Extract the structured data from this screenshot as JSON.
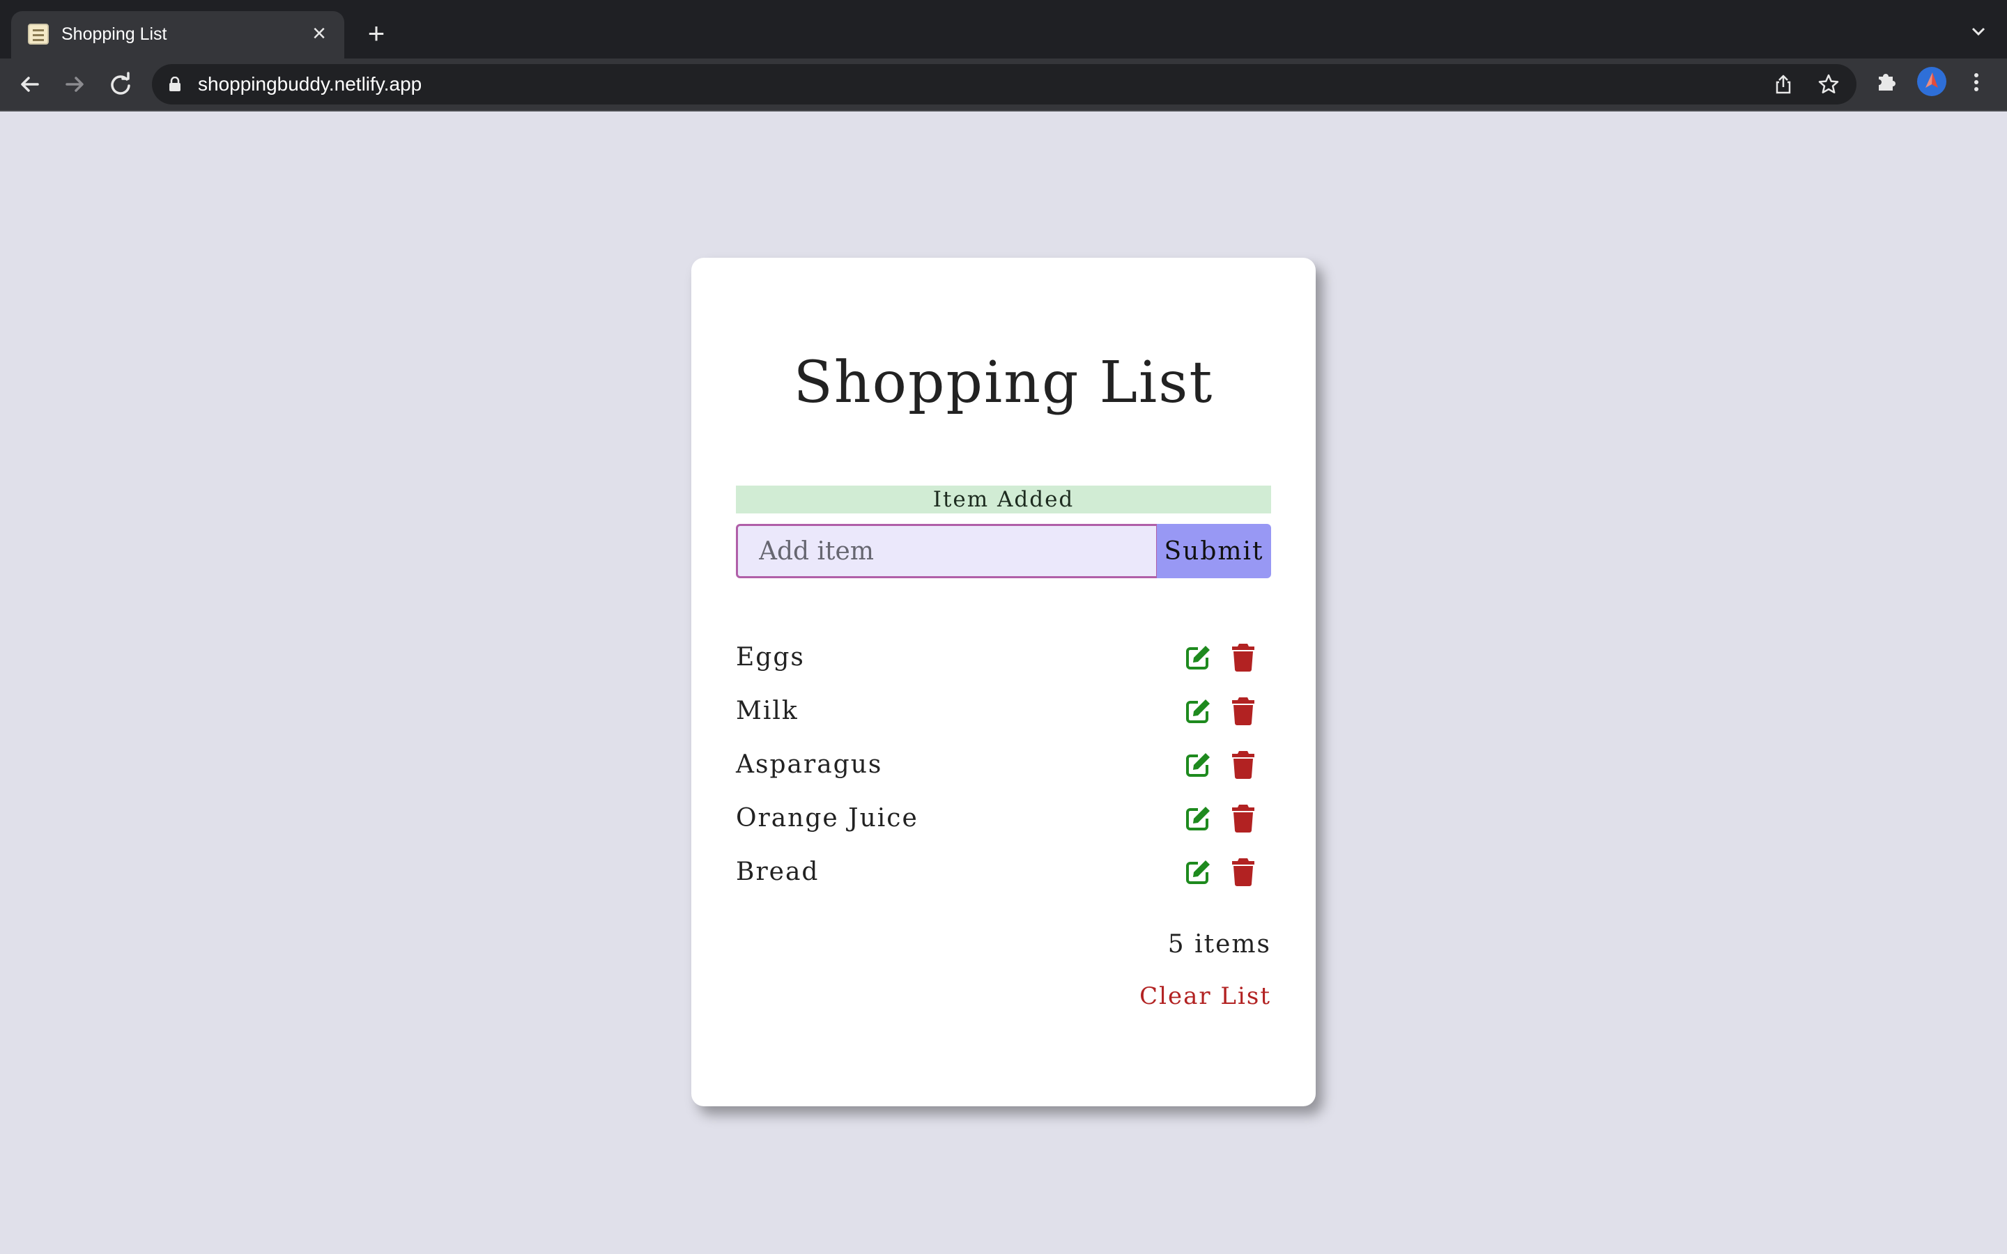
{
  "browser": {
    "tab_title": "Shopping List",
    "tab_favicon": "notepad-icon",
    "url": "shoppingbuddy.netlify.app"
  },
  "app": {
    "title": "Shopping List",
    "alert": {
      "text": "Item Added",
      "color": "#d1ecd4"
    },
    "input": {
      "placeholder": "Add item",
      "value": ""
    },
    "submit_label": "Submit",
    "items": [
      {
        "name": "Eggs"
      },
      {
        "name": "Milk"
      },
      {
        "name": "Asparagus"
      },
      {
        "name": "Orange Juice"
      },
      {
        "name": "Bread"
      }
    ],
    "item_count": "5 items",
    "clear_label": "Clear List"
  },
  "colors": {
    "edit": "#1e8a1e",
    "delete": "#b22222",
    "submit": "#9898f4",
    "background": "#e0e0ea"
  }
}
